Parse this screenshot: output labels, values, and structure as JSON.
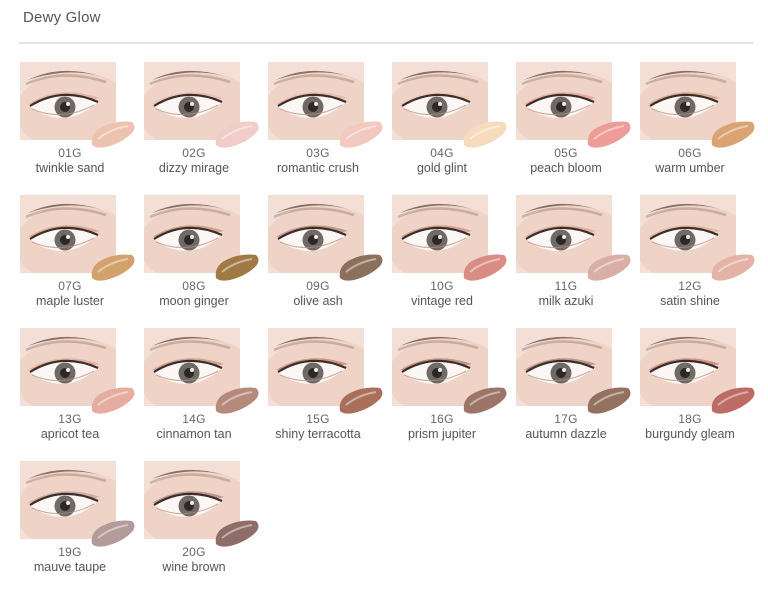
{
  "title": "Dewy Glow",
  "shades": [
    {
      "code": "01G",
      "name": "twinkle sand",
      "color": "#ecc3ae",
      "lid": "#e1b29c"
    },
    {
      "code": "02G",
      "name": "dizzy mirage",
      "color": "#f0cdc8",
      "lid": "#e6bcb3"
    },
    {
      "code": "03G",
      "name": "romantic crush",
      "color": "#f1c9bf",
      "lid": "#e7b9aa"
    },
    {
      "code": "04G",
      "name": "gold glint",
      "color": "#f6dcbd",
      "lid": "#ecc9ab"
    },
    {
      "code": "05G",
      "name": "peach bloom",
      "color": "#ee9c97",
      "lid": "#e7a596"
    },
    {
      "code": "06G",
      "name": "warm umber",
      "color": "#d9a472",
      "lid": "#d7a383"
    },
    {
      "code": "07G",
      "name": "maple luster",
      "color": "#d3a16b",
      "lid": "#d3a282"
    },
    {
      "code": "08G",
      "name": "moon ginger",
      "color": "#9f7a45",
      "lid": "#c8987c"
    },
    {
      "code": "09G",
      "name": "olive ash",
      "color": "#8d6f5d",
      "lid": "#b98e7c"
    },
    {
      "code": "10G",
      "name": "vintage red",
      "color": "#d98c84",
      "lid": "#d5958a"
    },
    {
      "code": "11G",
      "name": "milk azuki",
      "color": "#d9aea7",
      "lid": "#d9ab9e"
    },
    {
      "code": "12G",
      "name": "satin shine",
      "color": "#e3b4a5",
      "lid": "#dfb2a2"
    },
    {
      "code": "13G",
      "name": "apricot tea",
      "color": "#e4ad9f",
      "lid": "#e0ab98"
    },
    {
      "code": "14G",
      "name": "cinnamon tan",
      "color": "#b58a7a",
      "lid": "#c99984"
    },
    {
      "code": "15G",
      "name": "shiny terracotta",
      "color": "#a8705a",
      "lid": "#c58770"
    },
    {
      "code": "16G",
      "name": "prism jupiter",
      "color": "#9d7468",
      "lid": "#b98676"
    },
    {
      "code": "17G",
      "name": "autumn dazzle",
      "color": "#94705f",
      "lid": "#b58a78"
    },
    {
      "code": "18G",
      "name": "burgundy gleam",
      "color": "#bd6b65",
      "lid": "#c88478"
    },
    {
      "code": "19G",
      "name": "mauve taupe",
      "color": "#b29b98",
      "lid": "#c6a59d"
    },
    {
      "code": "20G",
      "name": "wine brown",
      "color": "#8e6d68",
      "lid": "#b38a80"
    }
  ]
}
